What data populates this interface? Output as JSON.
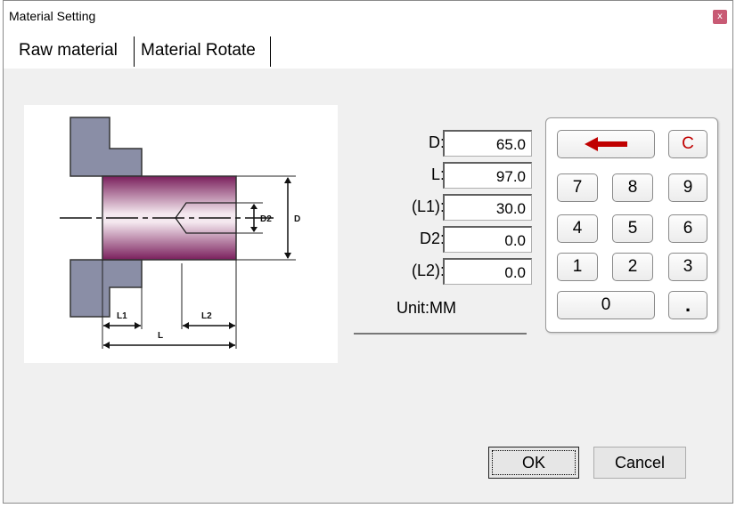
{
  "window": {
    "title": "Material Setting",
    "close_glyph": "x"
  },
  "tabs": [
    {
      "label": "Raw material",
      "active": true
    },
    {
      "label": "Material Rotate",
      "active": false
    }
  ],
  "diagram": {
    "labels": {
      "d2": "D2",
      "d": "D",
      "l1": "L1",
      "l2": "L2",
      "l": "L"
    },
    "colors": {
      "chuck": "#8a8ea6",
      "material_dark": "#7a1f5c",
      "material_light": "#f4e8ef"
    }
  },
  "fields": [
    {
      "label": "D:",
      "value": "65.0"
    },
    {
      "label": "L:",
      "value": "97.0"
    },
    {
      "label": "(L1):",
      "value": "30.0"
    },
    {
      "label": "D2:",
      "value": "0.0"
    },
    {
      "label": "(L2):",
      "value": "0.0"
    }
  ],
  "unit": "Unit:MM",
  "keypad": {
    "backspace_icon": "left-arrow-icon",
    "clear": "C",
    "digits": [
      "7",
      "8",
      "9",
      "4",
      "5",
      "6",
      "1",
      "2",
      "3",
      "0",
      "."
    ],
    "colors": {
      "backspace": "#c00000",
      "clear": "#c00000"
    }
  },
  "buttons": {
    "ok": "OK",
    "cancel": "Cancel"
  }
}
